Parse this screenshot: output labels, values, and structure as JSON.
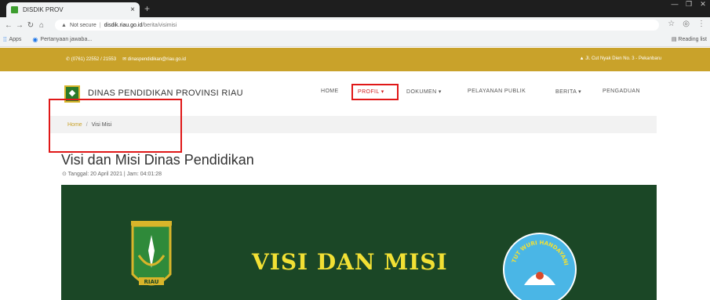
{
  "browser": {
    "tab_title": "DISDIK PROV",
    "tab_close": "×",
    "new_tab": "+",
    "security_label": "Not secure",
    "url_host": "disdik.riau.go.id",
    "url_path": "/berita/visimisi",
    "bookmarks": [
      {
        "label": "Apps"
      },
      {
        "label": "Pertanyaan jawaba..."
      }
    ],
    "reading_list": "Reading list"
  },
  "topbar": {
    "phone": "(0761) 22552 / 21553",
    "email": "dinaspendidikan@riau.go.id",
    "address": "Jl. Cut Nyak Dien No. 3 - Pekanbaru"
  },
  "header": {
    "site_name": "DINAS PENDIDIKAN PROVINSI RIAU",
    "nav": [
      {
        "label": "HOME"
      },
      {
        "label": "PROFIL ▾"
      },
      {
        "label": "DOKUMEN ▾"
      },
      {
        "label": "PELAYANAN PUBLIK"
      },
      {
        "label": "BERITA ▾"
      },
      {
        "label": "PENGADUAN"
      }
    ]
  },
  "breadcrumb": {
    "home": "Home",
    "separator": "/",
    "current": "Visi Misi"
  },
  "article": {
    "title": "Visi dan Misi Dinas Pendidikan",
    "meta": "⊙ Tanggal: 20 April 2021 | Jam: 04:01:28"
  },
  "banner": {
    "title": "VISI DAN MISI",
    "emblem_left_text": "RIAU",
    "emblem_right_text": "TUT WURI HANDAYANI",
    "bg_color": "#1b4726",
    "title_color": "#f2e034"
  },
  "colors": {
    "accent": "#c9a22a",
    "highlight_box": "#e01818"
  }
}
